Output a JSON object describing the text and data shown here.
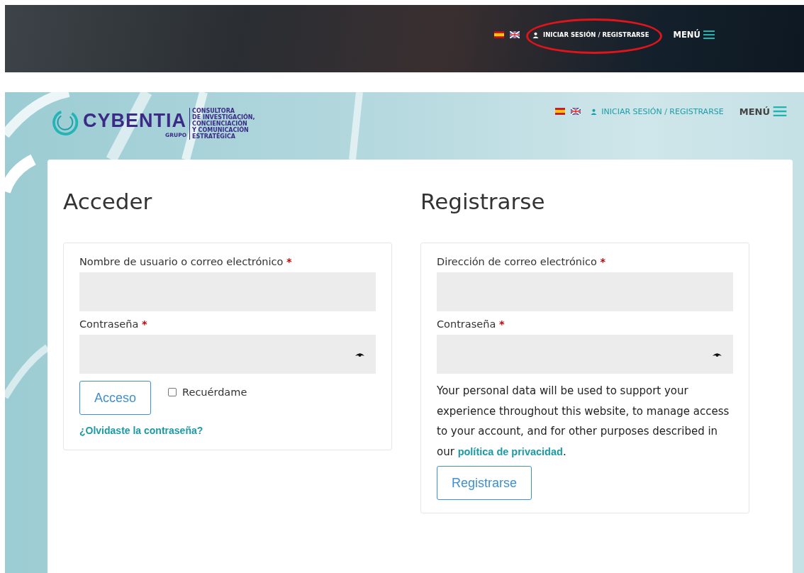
{
  "top_banner": {
    "login_link": "INICIAR SESIÓN / REGISTRARSE",
    "menu_label": "MENÚ",
    "highlighted": true
  },
  "header": {
    "logo": {
      "name": "CYBENTIA",
      "sub": "GRUPO",
      "tagline": [
        "CONSULTORA",
        "DE INVESTIGACIÓN,",
        "CONCIENCIACIÓN",
        "Y COMUNICACIÓN",
        "ESTRATÉGICA"
      ]
    },
    "login_link": "INICIAR SESIÓN / REGISTRARSE",
    "menu_label": "MENÚ"
  },
  "login": {
    "title": "Acceder",
    "fields": [
      {
        "label": "Nombre de usuario o correo electrónico",
        "required_mark": "*",
        "kind": "text"
      },
      {
        "label": "Contraseña",
        "required_mark": "*",
        "kind": "password"
      }
    ],
    "button": "Acceso",
    "remember": {
      "label": "Recuérdame",
      "checked": false
    },
    "lost_password": "¿Olvidaste la contraseña?"
  },
  "register": {
    "title": "Registrarse",
    "fields": [
      {
        "label": "Dirección de correo electrónico",
        "required_mark": "*",
        "kind": "text"
      },
      {
        "label": "Contraseña",
        "required_mark": "*",
        "kind": "password"
      }
    ],
    "privacy_text": "Your personal data will be used to support your experience throughout this website, to manage access to your account, and for other purposes described in our",
    "privacy_link": "política de privacidad",
    "privacy_end": ".",
    "button": "Registrarse"
  }
}
